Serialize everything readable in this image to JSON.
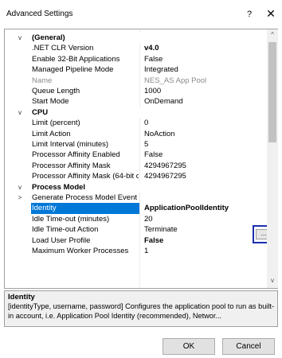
{
  "window": {
    "title": "Advanced Settings",
    "help_label": "?",
    "close_label": "✕"
  },
  "grid": {
    "rows": [
      {
        "kind": "category",
        "glyph": "v",
        "name": "(General)",
        "value": ""
      },
      {
        "kind": "prop",
        "name": ".NET CLR Version",
        "value": "v4.0",
        "value_bold": true
      },
      {
        "kind": "prop",
        "name": "Enable 32-Bit Applications",
        "value": "False"
      },
      {
        "kind": "prop",
        "name": "Managed Pipeline Mode",
        "value": "Integrated"
      },
      {
        "kind": "prop",
        "name": "Name",
        "value": "NES_AS App Pool",
        "disabled": true
      },
      {
        "kind": "prop",
        "name": "Queue Length",
        "value": "1000"
      },
      {
        "kind": "prop",
        "name": "Start Mode",
        "value": "OnDemand"
      },
      {
        "kind": "category",
        "glyph": "v",
        "name": "CPU",
        "value": ""
      },
      {
        "kind": "prop",
        "name": "Limit (percent)",
        "value": "0"
      },
      {
        "kind": "prop",
        "name": "Limit Action",
        "value": "NoAction"
      },
      {
        "kind": "prop",
        "name": "Limit Interval (minutes)",
        "value": "5"
      },
      {
        "kind": "prop",
        "name": "Processor Affinity Enabled",
        "value": "False"
      },
      {
        "kind": "prop",
        "name": "Processor Affinity Mask",
        "value": "4294967295"
      },
      {
        "kind": "prop",
        "name": "Processor Affinity Mask (64-bit c",
        "value": "4294967295"
      },
      {
        "kind": "category",
        "glyph": "v",
        "name": "Process Model",
        "value": ""
      },
      {
        "kind": "prop",
        "glyph": ">",
        "name": "Generate Process Model Event L",
        "value": ""
      },
      {
        "kind": "prop",
        "name": "Identity",
        "value": "ApplicationPoolIdentity",
        "value_bold": true,
        "selected": true
      },
      {
        "kind": "prop",
        "name": "Idle Time-out (minutes)",
        "value": "20"
      },
      {
        "kind": "prop",
        "name": "Idle Time-out Action",
        "value": "Terminate"
      },
      {
        "kind": "prop",
        "name": "Load User Profile",
        "value": "False",
        "value_bold": true
      },
      {
        "kind": "prop",
        "name": "Maximum Worker Processes",
        "value": "1"
      }
    ],
    "ellipsis_label": "...",
    "scroll_up": "^",
    "scroll_down": "v"
  },
  "description": {
    "title": "Identity",
    "text": "[identityType, username, password] Configures the application pool to run as built-in account, i.e. Application Pool Identity (recommended), Networ..."
  },
  "buttons": {
    "ok": "OK",
    "cancel": "Cancel"
  }
}
